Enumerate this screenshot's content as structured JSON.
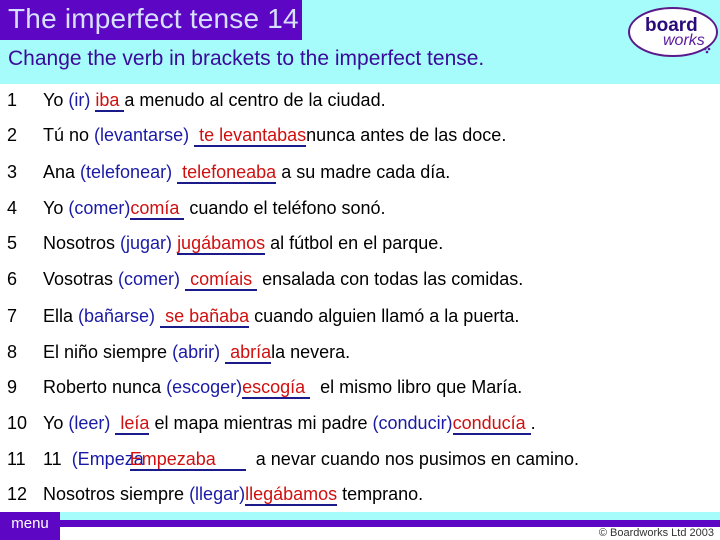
{
  "header": {
    "title": "The imperfect tense 14",
    "instruction": "Change the verb in brackets to the imperfect tense.",
    "logo": {
      "line1": "board",
      "line2": "works"
    }
  },
  "colors": {
    "title_bg": "#5d06c3",
    "header_bg": "#a6fbfb",
    "verb_color": "#1a1aa6",
    "answer_color": "#d01010"
  },
  "exercises": [
    {
      "num": "1",
      "pre": "Yo ",
      "verb": "(ir)",
      "answer": "iba ",
      "post": "a menudo al centro de la ciudad."
    },
    {
      "num": "2",
      "pre": "Tú no ",
      "verb": "(levantarse)",
      "answer": " te levantabas",
      "post": "nunca antes de las doce."
    },
    {
      "num": "3",
      "pre": "Ana ",
      "verb": "(telefonear)",
      "answer": " telefoneaba",
      "post": " a su madre cada día."
    },
    {
      "num": "4",
      "pre": "Yo ",
      "verb": "(comer)",
      "answer": "comía ",
      "post": " cuando el teléfono sonó."
    },
    {
      "num": "5",
      "pre": "Nosotros ",
      "verb": "(jugar)",
      "answer": "jugábamos",
      "post": " al fútbol en el parque."
    },
    {
      "num": "6",
      "pre": "Vosotras ",
      "verb": "(comer)",
      "answer": " comíais ",
      "post": " ensalada con todas las comidas."
    },
    {
      "num": "7",
      "pre": "Ella ",
      "verb": "(bañarse)",
      "answer": " se bañaba",
      "post": " cuando alguien llamó a la puerta."
    },
    {
      "num": "8",
      "pre": "El niño siempre ",
      "verb": "(abrir)",
      "answer": " abría",
      "post": "la nevera."
    },
    {
      "num": "9",
      "pre": "Roberto nunca ",
      "verb": "(escoger)",
      "answer": "escogía ",
      "post": "  el mismo libro que María."
    },
    {
      "num": "10",
      "pre": "Yo ",
      "verb": "(leer)",
      "answer": " leía",
      "post": " el mapa mientras mi padre ",
      "verb2": "(conducir)",
      "answer2": "conducía ",
      "post2": "."
    },
    {
      "num": "11",
      "pre": "11  ",
      "verb": "(Empeza",
      "answer": "Empezaba      ",
      "post": "  a nevar cuando nos pusimos en camino."
    },
    {
      "num": "12",
      "pre": "Nosotros siempre ",
      "verb": "(llegar)",
      "answer": "llegábamos",
      "post": " temprano."
    }
  ],
  "footer": {
    "menu_label": "menu",
    "copyright": "© Boardworks Ltd  2003"
  }
}
